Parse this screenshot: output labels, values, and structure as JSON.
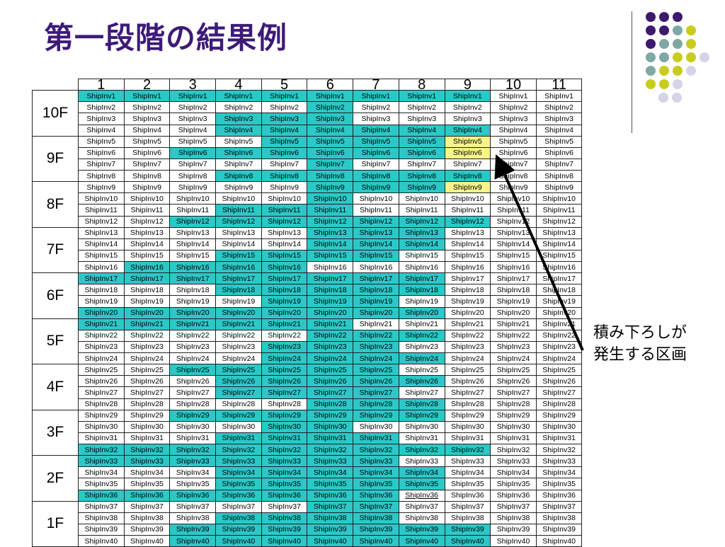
{
  "slide": {
    "title": "第一段階の結果例",
    "annotation_line1": "積み下ろしが",
    "annotation_line2": "発生する区画"
  },
  "colors": {
    "title": "#3d1a78",
    "highlight_cyan": "#2cc8c8",
    "highlight_yellow": "#f7f58a",
    "dot_purple": "#3d1a6e",
    "dot_teal": "#7fa8a5",
    "dot_olive": "#c8cc1c",
    "dot_lavender": "#d5d3e8"
  },
  "table": {
    "cell_prefix": "ShipInv",
    "columns": [
      "1",
      "2",
      "3",
      "4",
      "5",
      "6",
      "7",
      "8",
      "9",
      "10",
      "11"
    ],
    "floors": [
      "10F",
      "9F",
      "8F",
      "7F",
      "6F",
      "5F",
      "4F",
      "3F",
      "2F",
      "1F"
    ],
    "highlights": [
      [
        "c",
        "c",
        "c",
        "c",
        "c",
        "c",
        "c",
        "c",
        "c",
        "",
        ""
      ],
      [
        "",
        "",
        "",
        "",
        "",
        "c",
        "",
        "",
        "",
        "",
        ""
      ],
      [
        "",
        "",
        "",
        "c",
        "c",
        "c",
        "",
        "",
        "",
        "",
        ""
      ],
      [
        "",
        "",
        "",
        "c",
        "c",
        "c",
        "c",
        "c",
        "c",
        "",
        ""
      ],
      [
        "",
        "",
        "",
        "",
        "c",
        "c",
        "c",
        "c",
        "y",
        "",
        ""
      ],
      [
        "",
        "",
        "c",
        "c",
        "c",
        "c",
        "c",
        "c",
        "y",
        "",
        ""
      ],
      [
        "",
        "",
        "",
        "",
        "",
        "c",
        "",
        "",
        "",
        "",
        ""
      ],
      [
        "",
        "",
        "",
        "c",
        "c",
        "c",
        "c",
        "c",
        "c",
        "",
        ""
      ],
      [
        "",
        "",
        "",
        "",
        "",
        "c",
        "c",
        "c",
        "y",
        "",
        ""
      ],
      [
        "",
        "",
        "",
        "",
        "",
        "c",
        "",
        "",
        "",
        "",
        ""
      ],
      [
        "",
        "",
        "",
        "c",
        "c",
        "c",
        "",
        "",
        "",
        "",
        ""
      ],
      [
        "",
        "",
        "c",
        "c",
        "c",
        "c",
        "c",
        "c",
        "c",
        "",
        ""
      ],
      [
        "",
        "",
        "",
        "",
        "",
        "c",
        "c",
        "c",
        "",
        "",
        ""
      ],
      [
        "",
        "",
        "",
        "",
        "",
        "c",
        "c",
        "c",
        "",
        "",
        ""
      ],
      [
        "",
        "",
        "",
        "c",
        "c",
        "c",
        "c",
        "",
        "",
        "",
        ""
      ],
      [
        "",
        "c",
        "c",
        "c",
        "c",
        "",
        "",
        "",
        "",
        "",
        ""
      ],
      [
        "c",
        "c",
        "c",
        "c",
        "c",
        "c",
        "c",
        "c",
        "",
        "",
        ""
      ],
      [
        "",
        "",
        "",
        "c",
        "c",
        "c",
        "c",
        "c",
        "",
        "",
        ""
      ],
      [
        "",
        "",
        "",
        "",
        "c",
        "c",
        "c",
        "",
        "",
        "",
        ""
      ],
      [
        "c",
        "c",
        "c",
        "c",
        "c",
        "c",
        "c",
        "c",
        "",
        "",
        ""
      ],
      [
        "c",
        "c",
        "c",
        "c",
        "c",
        "c",
        "",
        "",
        "",
        "",
        ""
      ],
      [
        "",
        "",
        "",
        "",
        "",
        "c",
        "c",
        "c",
        "",
        "",
        ""
      ],
      [
        "",
        "",
        "",
        "",
        "c",
        "c",
        "c",
        "",
        "",
        "",
        ""
      ],
      [
        "",
        "",
        "",
        "",
        "c",
        "c",
        "c",
        "c",
        "",
        "",
        ""
      ],
      [
        "",
        "",
        "c",
        "c",
        "c",
        "c",
        "c",
        "",
        "",
        "",
        ""
      ],
      [
        "",
        "",
        "",
        "c",
        "c",
        "c",
        "c",
        "c",
        "",
        "",
        ""
      ],
      [
        "",
        "",
        "",
        "c",
        "c",
        "c",
        "c",
        "",
        "",
        "",
        ""
      ],
      [
        "",
        "",
        "",
        "",
        "",
        "c",
        "c",
        "c",
        "",
        "",
        ""
      ],
      [
        "",
        "",
        "c",
        "c",
        "c",
        "c",
        "c",
        "c",
        "",
        "",
        ""
      ],
      [
        "",
        "",
        "",
        "",
        "c",
        "c",
        "",
        "",
        "",
        "",
        ""
      ],
      [
        "",
        "",
        "",
        "c",
        "c",
        "c",
        "c",
        "",
        "",
        "",
        ""
      ],
      [
        "c",
        "c",
        "c",
        "c",
        "c",
        "c",
        "c",
        "c",
        "c",
        "",
        ""
      ],
      [
        "c",
        "c",
        "c",
        "c",
        "c",
        "c",
        "c",
        "",
        "",
        "",
        ""
      ],
      [
        "",
        "",
        "",
        "c",
        "c",
        "c",
        "c",
        "c",
        "",
        "",
        ""
      ],
      [
        "",
        "",
        "",
        "c",
        "c",
        "c",
        "c",
        "c",
        "",
        "",
        ""
      ],
      [
        "c",
        "c",
        "c",
        "c",
        "c",
        "c",
        "c",
        "u",
        "",
        "",
        ""
      ],
      [
        "",
        "",
        "",
        "",
        "",
        "c",
        "c",
        "",
        "",
        "",
        ""
      ],
      [
        "",
        "",
        "",
        "c",
        "c",
        "c",
        "c",
        "",
        "",
        "",
        ""
      ],
      [
        "",
        "",
        "c",
        "c",
        "c",
        "c",
        "c",
        "c",
        "c",
        "",
        ""
      ],
      [
        "",
        "",
        "c",
        "c",
        "c",
        "c",
        "c",
        "c",
        "c",
        "",
        ""
      ]
    ]
  }
}
